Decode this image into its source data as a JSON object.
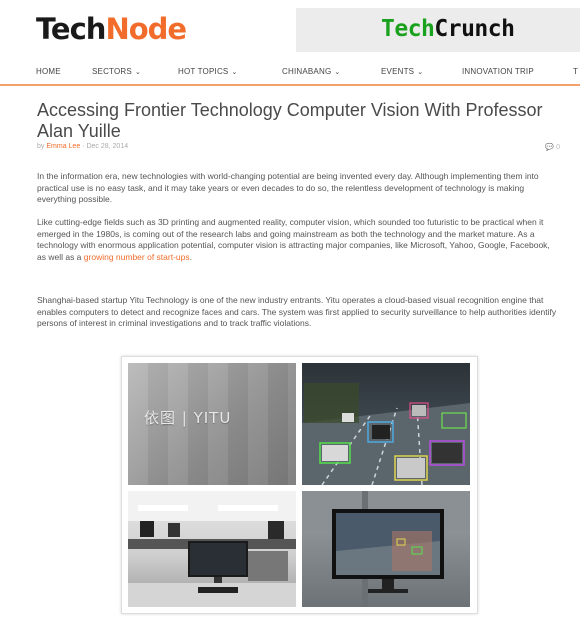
{
  "header": {
    "logo_left_part1": "Tech",
    "logo_left_part2": "Node",
    "logo_right_part1": "Tech",
    "logo_right_part2": "Crunch"
  },
  "nav": {
    "items": [
      {
        "label": "HOME",
        "dropdown": false
      },
      {
        "label": "SECTORS",
        "dropdown": true
      },
      {
        "label": "HOT TOPICS",
        "dropdown": true
      },
      {
        "label": "CHINABANG",
        "dropdown": true
      },
      {
        "label": "EVENTS",
        "dropdown": true
      },
      {
        "label": "INNOVATION TRIP",
        "dropdown": false
      },
      {
        "label": "T",
        "dropdown": false
      }
    ]
  },
  "article": {
    "title": "Accessing Frontier Technology Computer Vision With Professor Alan Yuille",
    "byline_prefix": "by",
    "author": "Emma Lee",
    "date": "Dec 28, 2014",
    "comment_count": "0",
    "paragraphs": {
      "p1": "In the information era, new technologies with world-changing potential are being invented every day. Although implementing them into practical use is no easy task, and it may take years or even decades to do so, the relentless development of technology is making everything possible.",
      "p2_text": "Like cutting-edge fields such as 3D printing and augmented reality, computer vision, which sounded too futuristic to be practical when it emerged in the 1980s, is coming out of the research labs and going mainstream as both the technology and the market mature. As a technology with enormous application potential, computer vision is attracting major companies, like Microsoft, Yahoo, Google, Facebook, as well as a ",
      "p2_link": "growing number of start-ups",
      "p2_end": ".",
      "p3": "Shanghai-based startup Yitu Technology is one of the new industry entrants. Yitu operates a cloud-based visual recognition engine that enables computers to detect and recognize faces and cars. The system was first applied to security surveillance to help authorities identify persons of interest in criminal investigations and to track traffic violations."
    },
    "image_sign": "依图 | YITU"
  },
  "colors": {
    "accent": "#f26c2b",
    "techcrunch_green": "#1aa11d"
  }
}
